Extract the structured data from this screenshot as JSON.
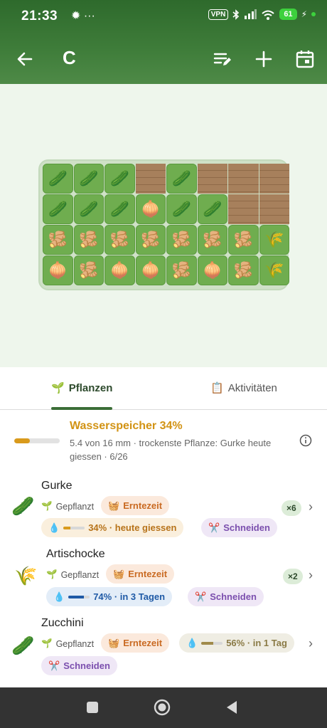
{
  "status": {
    "time": "21:33",
    "left_icons": "✹ ···",
    "vpn": "VPN",
    "battery": "61"
  },
  "appbar": {
    "title": "C"
  },
  "garden": {
    "rows": [
      [
        "cucumber",
        "cucumber",
        "cucumber",
        "empty",
        "cucumber",
        "empty",
        "empty",
        "empty"
      ],
      [
        "cucumber",
        "cucumber",
        "cucumber",
        "onion",
        "cucumber",
        "cucumber",
        "empty",
        "empty"
      ],
      [
        "ginger",
        "ginger",
        "ginger",
        "ginger",
        "ginger",
        "ginger",
        "ginger",
        "artichoke"
      ],
      [
        "onion",
        "ginger",
        "onion",
        "onion",
        "ginger",
        "onion",
        "ginger",
        "artichoke"
      ]
    ],
    "glyphs": {
      "cucumber": "🥒",
      "onion": "🧅",
      "ginger": "🫚",
      "artichoke": "🌾",
      "empty": ""
    }
  },
  "tabs": {
    "plants": {
      "icon": "🌱",
      "label": "Pflanzen"
    },
    "activities": {
      "icon": "📋",
      "label": "Aktivitäten"
    }
  },
  "water": {
    "title": "Wasserspeicher 34%",
    "subtitle": "5.4 von 16 mm · trockenste Pflanze: Gurke heute giessen · 6/26",
    "level_percent": 34
  },
  "plants": [
    {
      "name": "Gurke",
      "icon": "🥒",
      "status": "Gepflanzt",
      "harvest": "Erntezeit",
      "water_text": "34% · heute giessen",
      "water_percent": 34,
      "cut": "Schneiden",
      "count": "×6"
    },
    {
      "name": "Artischocke",
      "icon": "🌾",
      "status": "Gepflanzt",
      "harvest": "Erntezeit",
      "water_text": "74% · in 3 Tagen",
      "water_percent": 74,
      "cut": "Schneiden",
      "count": "×2"
    },
    {
      "name": "Zucchini",
      "icon": "🥒",
      "status": "Gepflanzt",
      "harvest": "Erntezeit",
      "water_text": "56% · in 1 Tag",
      "water_percent": 56,
      "cut": "Schneiden",
      "count": ""
    }
  ],
  "colors": {
    "accent": "#3b6e37",
    "water_warn": "#d99a1c",
    "water_ok": "#1f5aa6",
    "water_mid": "#a08a4a"
  },
  "icons": {
    "harvest": "🧺",
    "sprout": "🌱",
    "drop": "💧",
    "scissors": "✂️"
  }
}
